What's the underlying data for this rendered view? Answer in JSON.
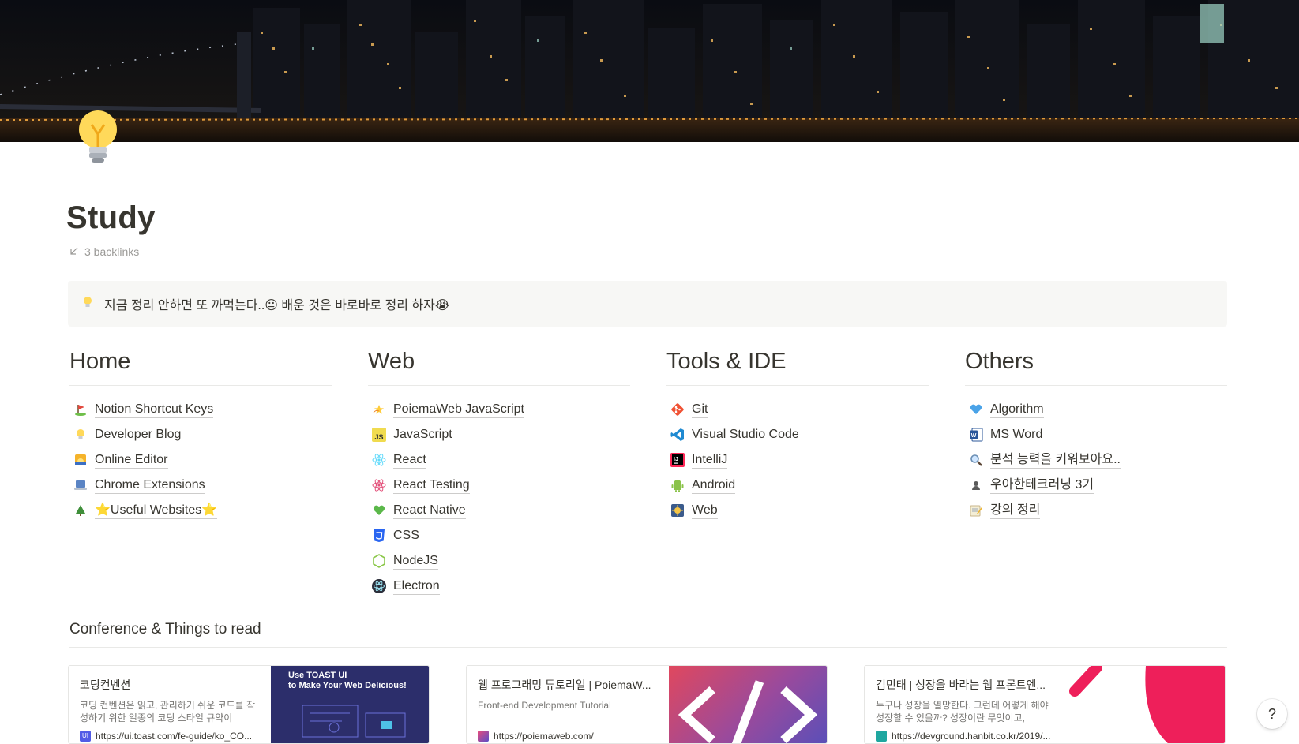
{
  "page": {
    "title": "Study",
    "backlinks": "3 backlinks",
    "callout": "지금 정리 안하면 또 까먹는다..😐 배운 것은 바로바로 정리 하자😭"
  },
  "columns": [
    {
      "heading": "Home",
      "items": [
        {
          "label": "Notion Shortcut Keys",
          "icon": "golf-icon"
        },
        {
          "label": "Developer Blog",
          "icon": "lightbulb-icon"
        },
        {
          "label": "Online Editor",
          "icon": "sunrise-icon"
        },
        {
          "label": "Chrome Extensions",
          "icon": "laptop-icon"
        },
        {
          "label": "⭐Useful Websites⭐",
          "icon": "tree-icon"
        }
      ]
    },
    {
      "heading": "Web",
      "items": [
        {
          "label": "PoiemaWeb JavaScript",
          "icon": "dizzy-icon"
        },
        {
          "label": "JavaScript",
          "icon": "js-icon"
        },
        {
          "label": "React",
          "icon": "react-icon"
        },
        {
          "label": "React Testing",
          "icon": "react-pink-icon"
        },
        {
          "label": "React Native",
          "icon": "green-heart-icon"
        },
        {
          "label": "CSS",
          "icon": "css-icon"
        },
        {
          "label": "NodeJS",
          "icon": "node-icon"
        },
        {
          "label": "Electron",
          "icon": "electron-icon"
        }
      ]
    },
    {
      "heading": "Tools & IDE",
      "items": [
        {
          "label": "Git",
          "icon": "git-icon"
        },
        {
          "label": "Visual Studio Code",
          "icon": "vscode-icon"
        },
        {
          "label": "IntelliJ",
          "icon": "intellij-icon"
        },
        {
          "label": "Android",
          "icon": "android-icon"
        },
        {
          "label": "Web",
          "icon": "web-icon"
        }
      ]
    },
    {
      "heading": "Others",
      "items": [
        {
          "label": "Algorithm",
          "icon": "blue-heart-icon"
        },
        {
          "label": "MS Word",
          "icon": "word-icon"
        },
        {
          "label": "분석 능력을 키워보아요..",
          "icon": "magnifier-icon"
        },
        {
          "label": "우아한테크러닝 3기",
          "icon": "bust-icon"
        },
        {
          "label": "강의 정리",
          "icon": "memo-icon"
        }
      ]
    }
  ],
  "conference": {
    "heading": "Conference & Things to read",
    "cards": [
      {
        "title": "코딩컨벤션",
        "desc": "코딩 컨벤션은 읽고, 관리하기 쉬운 코드를 작성하기 위한 일종의 코딩 스타일 규약이",
        "url": "https://ui.toast.com/fe-guide/ko_CO...",
        "thumb_text_1": "Use TOAST UI",
        "thumb_text_2": "to Make Your Web Delicious!",
        "favicon_text": "UI"
      },
      {
        "title": "웹 프로그래밍 튜토리얼 | PoiemaW...",
        "desc": "Front-end Development Tutorial",
        "url": "https://poiemaweb.com/",
        "thumb_text_1": "",
        "thumb_text_2": "",
        "favicon_text": ""
      },
      {
        "title": "김민태 | 성장을 바라는 웹 프론트엔...",
        "desc": "누구나 성장을 열망한다. 그런데 어떻게 해야 성장할 수 있을까? 성장이란 무엇이고,",
        "url": "https://devground.hanbit.co.kr/2019/...",
        "thumb_text_1": "",
        "thumb_text_2": "",
        "favicon_text": ""
      }
    ]
  },
  "help_label": "?",
  "colors": {
    "text": "#37352f",
    "muted": "#9b9a97",
    "callout_bg": "#f7f7f5",
    "divider": "#e9e9e7"
  }
}
